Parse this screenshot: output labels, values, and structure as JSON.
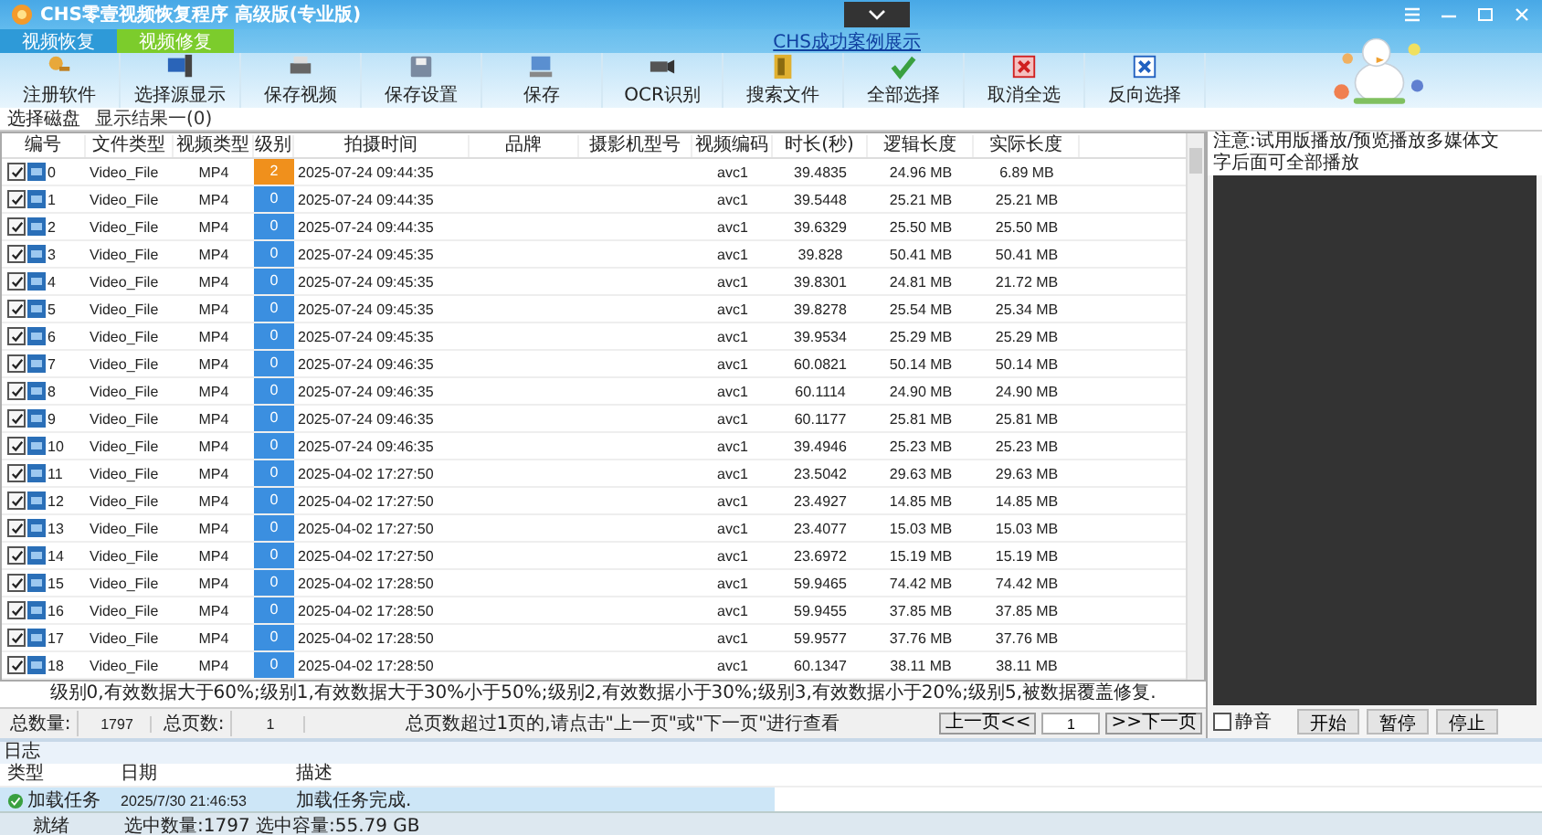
{
  "window": {
    "title": "CHS零壹视频恢复程序 高级版(专业版)"
  },
  "tabs": [
    {
      "label": "视频恢复",
      "selected": false
    },
    {
      "label": "视频修复",
      "selected": true
    }
  ],
  "case_link": "CHS成功案例展示",
  "toolbar": [
    "注册软件",
    "选择源显示",
    "保存视频",
    "保存设置",
    "保存",
    "OCR识别",
    "搜索文件",
    "全部选择",
    "取消全选",
    "反向选择"
  ],
  "source_bar": {
    "label": "选择磁盘",
    "result": "显示结果一(0)"
  },
  "table": {
    "columns": [
      "编号",
      "文件类型",
      "视频类型",
      "级别",
      "拍摄时间",
      "品牌",
      "摄影机型号",
      "视频编码",
      "时长(秒)",
      "逻辑长度",
      "实际长度"
    ],
    "rows": [
      {
        "index": "0",
        "checked": true,
        "file_type": "Video_File",
        "video_type": "MP4",
        "grade": "2",
        "shot_time": "2025-07-24 09:44:35",
        "codec": "avc1",
        "duration": "39.4835",
        "logical_size": "24.96 MB",
        "actual_size": "6.89 MB"
      },
      {
        "index": "1",
        "checked": true,
        "file_type": "Video_File",
        "video_type": "MP4",
        "grade": "0",
        "shot_time": "2025-07-24 09:44:35",
        "codec": "avc1",
        "duration": "39.5448",
        "logical_size": "25.21 MB",
        "actual_size": "25.21 MB"
      },
      {
        "index": "2",
        "checked": true,
        "file_type": "Video_File",
        "video_type": "MP4",
        "grade": "0",
        "shot_time": "2025-07-24 09:44:35",
        "codec": "avc1",
        "duration": "39.6329",
        "logical_size": "25.50 MB",
        "actual_size": "25.50 MB"
      },
      {
        "index": "3",
        "checked": true,
        "file_type": "Video_File",
        "video_type": "MP4",
        "grade": "0",
        "shot_time": "2025-07-24 09:45:35",
        "codec": "avc1",
        "duration": "39.828",
        "logical_size": "50.41 MB",
        "actual_size": "50.41 MB"
      },
      {
        "index": "4",
        "checked": true,
        "file_type": "Video_File",
        "video_type": "MP4",
        "grade": "0",
        "shot_time": "2025-07-24 09:45:35",
        "codec": "avc1",
        "duration": "39.8301",
        "logical_size": "24.81 MB",
        "actual_size": "21.72 MB"
      },
      {
        "index": "5",
        "checked": true,
        "file_type": "Video_File",
        "video_type": "MP4",
        "grade": "0",
        "shot_time": "2025-07-24 09:45:35",
        "codec": "avc1",
        "duration": "39.8278",
        "logical_size": "25.54 MB",
        "actual_size": "25.34 MB"
      },
      {
        "index": "6",
        "checked": true,
        "file_type": "Video_File",
        "video_type": "MP4",
        "grade": "0",
        "shot_time": "2025-07-24 09:45:35",
        "codec": "avc1",
        "duration": "39.9534",
        "logical_size": "25.29 MB",
        "actual_size": "25.29 MB"
      },
      {
        "index": "7",
        "checked": true,
        "file_type": "Video_File",
        "video_type": "MP4",
        "grade": "0",
        "shot_time": "2025-07-24 09:46:35",
        "codec": "avc1",
        "duration": "60.0821",
        "logical_size": "50.14 MB",
        "actual_size": "50.14 MB"
      },
      {
        "index": "8",
        "checked": true,
        "file_type": "Video_File",
        "video_type": "MP4",
        "grade": "0",
        "shot_time": "2025-07-24 09:46:35",
        "codec": "avc1",
        "duration": "60.1114",
        "logical_size": "24.90 MB",
        "actual_size": "24.90 MB"
      },
      {
        "index": "9",
        "checked": true,
        "file_type": "Video_File",
        "video_type": "MP4",
        "grade": "0",
        "shot_time": "2025-07-24 09:46:35",
        "codec": "avc1",
        "duration": "60.1177",
        "logical_size": "25.81 MB",
        "actual_size": "25.81 MB"
      },
      {
        "index": "10",
        "checked": true,
        "file_type": "Video_File",
        "video_type": "MP4",
        "grade": "0",
        "shot_time": "2025-07-24 09:46:35",
        "codec": "avc1",
        "duration": "39.4946",
        "logical_size": "25.23 MB",
        "actual_size": "25.23 MB"
      },
      {
        "index": "11",
        "checked": true,
        "file_type": "Video_File",
        "video_type": "MP4",
        "grade": "0",
        "shot_time": "2025-04-02 17:27:50",
        "codec": "avc1",
        "duration": "23.5042",
        "logical_size": "29.63 MB",
        "actual_size": "29.63 MB"
      },
      {
        "index": "12",
        "checked": true,
        "file_type": "Video_File",
        "video_type": "MP4",
        "grade": "0",
        "shot_time": "2025-04-02 17:27:50",
        "codec": "avc1",
        "duration": "23.4927",
        "logical_size": "14.85 MB",
        "actual_size": "14.85 MB"
      },
      {
        "index": "13",
        "checked": true,
        "file_type": "Video_File",
        "video_type": "MP4",
        "grade": "0",
        "shot_time": "2025-04-02 17:27:50",
        "codec": "avc1",
        "duration": "23.4077",
        "logical_size": "15.03 MB",
        "actual_size": "15.03 MB"
      },
      {
        "index": "14",
        "checked": true,
        "file_type": "Video_File",
        "video_type": "MP4",
        "grade": "0",
        "shot_time": "2025-04-02 17:27:50",
        "codec": "avc1",
        "duration": "23.6972",
        "logical_size": "15.19 MB",
        "actual_size": "15.19 MB"
      },
      {
        "index": "15",
        "checked": true,
        "file_type": "Video_File",
        "video_type": "MP4",
        "grade": "0",
        "shot_time": "2025-04-02 17:28:50",
        "codec": "avc1",
        "duration": "59.9465",
        "logical_size": "74.42 MB",
        "actual_size": "74.42 MB"
      },
      {
        "index": "16",
        "checked": true,
        "file_type": "Video_File",
        "video_type": "MP4",
        "grade": "0",
        "shot_time": "2025-04-02 17:28:50",
        "codec": "avc1",
        "duration": "59.9455",
        "logical_size": "37.85 MB",
        "actual_size": "37.85 MB"
      },
      {
        "index": "17",
        "checked": true,
        "file_type": "Video_File",
        "video_type": "MP4",
        "grade": "0",
        "shot_time": "2025-04-02 17:28:50",
        "codec": "avc1",
        "duration": "59.9577",
        "logical_size": "37.76 MB",
        "actual_size": "37.76 MB"
      },
      {
        "index": "18",
        "checked": true,
        "file_type": "Video_File",
        "video_type": "MP4",
        "grade": "0",
        "shot_time": "2025-04-02 17:28:50",
        "codec": "avc1",
        "duration": "60.1347",
        "logical_size": "38.11 MB",
        "actual_size": "38.11 MB"
      }
    ]
  },
  "legend": "级别0,有效数据大于60%;级别1,有效数据大于30%小于50%;级别2,有效数据小于30%;级别3,有效数据小于20%;级别5,被数据覆盖修复.",
  "pagination": {
    "total_label": "总数量:",
    "total": "1797",
    "pages_label": "总页数:",
    "pages": "1",
    "hint": "总页数超过1页的,请点击\"上一页\"或\"下一页\"进行查看",
    "prev": "上一页<<",
    "page": "1",
    "next": ">>下一页"
  },
  "preview": {
    "notice_start": "注意:试用版播放/预览播放多媒体文",
    "notice_end": "字后面可全部播放",
    "mute": {
      "label": "静音",
      "checked": false
    },
    "buttons": [
      "开始",
      "暂停",
      "停止"
    ]
  },
  "log": {
    "title": "日志",
    "columns": [
      "类型",
      "日期",
      "描述"
    ],
    "rows": [
      {
        "type": "加载任务",
        "date": "2025/7/30 21:46:53",
        "description": "加载任务完成.",
        "selected": true
      }
    ]
  },
  "status_bar": {
    "state": "就绪",
    "selection": "选中数量:1797 选中容量:55.79 GB"
  }
}
